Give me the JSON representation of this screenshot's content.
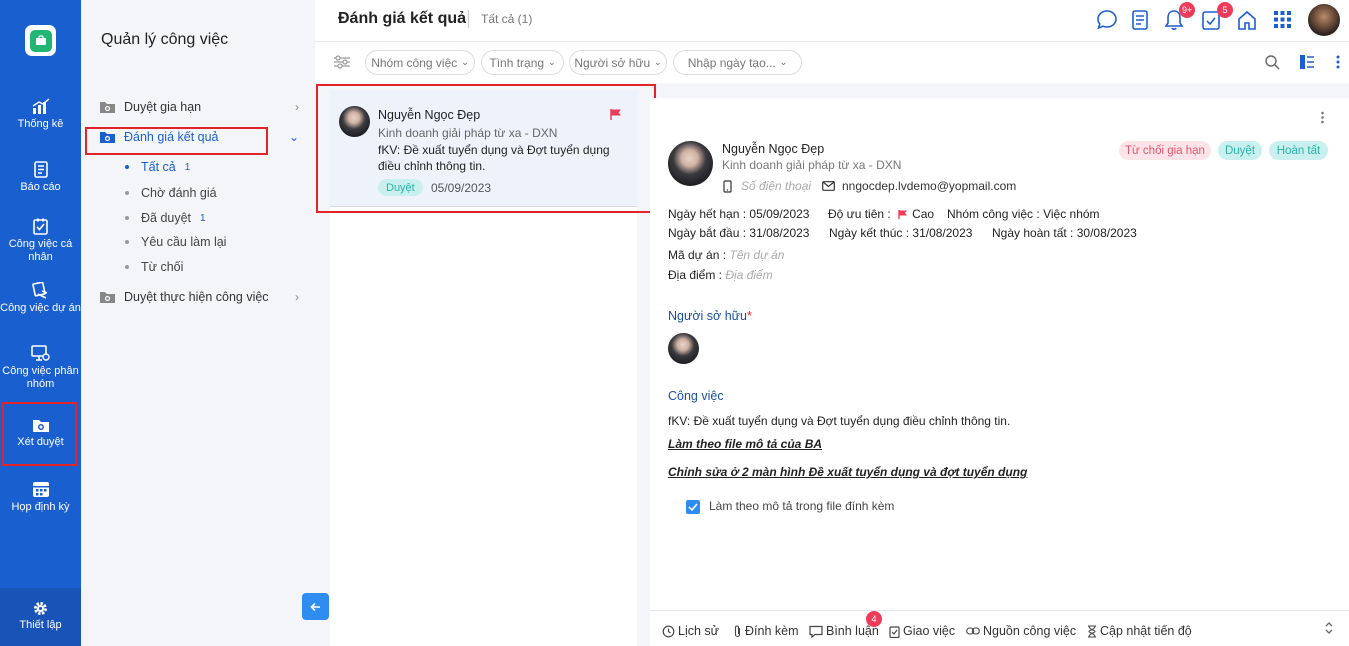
{
  "rail": {
    "items": [
      {
        "label": "Thống kê",
        "icon": "chart-icon"
      },
      {
        "label": "Báo cáo",
        "icon": "report-icon"
      },
      {
        "label": "Công việc cá nhân",
        "icon": "personal-task-icon"
      },
      {
        "label": "Công việc dự án",
        "icon": "project-task-icon"
      },
      {
        "label": "Công việc phân nhóm",
        "icon": "group-task-icon"
      },
      {
        "label": "Xét duyệt",
        "icon": "approval-folder-icon"
      },
      {
        "label": "Họp định kỳ",
        "icon": "calendar-icon"
      }
    ],
    "settings_label": "Thiết lập"
  },
  "sidebar": {
    "title": "Quản lý công việc",
    "groups": [
      {
        "label": "Duyệt gia hạn"
      },
      {
        "label": "Đánh giá kết quả"
      },
      {
        "label": "Duyệt thực hiện công việc"
      }
    ],
    "subitems": [
      {
        "label": "Tất cả",
        "count": "1"
      },
      {
        "label": "Chờ đánh giá",
        "count": ""
      },
      {
        "label": "Đã duyệt",
        "count": "1"
      },
      {
        "label": "Yêu cầu làm lại",
        "count": ""
      },
      {
        "label": "Từ chối",
        "count": ""
      }
    ]
  },
  "header": {
    "title": "Đánh giá kết quả",
    "count_label": "Tất cả (1)",
    "notif_badge": "9+",
    "task_badge": "5"
  },
  "filters": {
    "chips": [
      "Nhóm công việc",
      "Tình trạng",
      "Người sở hữu",
      "Nhập ngày tạo..."
    ]
  },
  "card": {
    "name": "Nguyễn Ngọc Đẹp",
    "dept": "Kinh doanh giải pháp từ xa - DXN",
    "desc": "fKV: Đề xuất tuyển dụng và Đợt tuyển dụng điều chỉnh thông tin.",
    "tag": "Duyệt",
    "date": "05/09/2023"
  },
  "detail": {
    "name": "Nguyễn Ngọc Đẹp",
    "dept": "Kinh doanh giải pháp từ xa - DXN",
    "phone_placeholder": "Số điện thoại",
    "email": "nngocdep.lvdemo@yopmail.com",
    "pills": [
      "Từ chối gia hạn",
      "Duyệt",
      "Hoàn tất"
    ],
    "due_label": "Ngày hết hạn :",
    "due": "05/09/2023",
    "priority_label": "Độ ưu tiên :",
    "priority": "Cao",
    "group_label": "Nhóm công việc :",
    "group": "Việc nhóm",
    "start_label": "Ngày bắt đầu :",
    "start": "31/08/2023",
    "end_label": "Ngày kết thúc :",
    "end": "31/08/2023",
    "done_label": "Ngày hoàn tất :",
    "done": "30/08/2023",
    "project_label": "Mã dự án :",
    "project_placeholder": "Tên dự án",
    "location_label": "Địa điểm :",
    "location_placeholder": "Địa điểm",
    "owner_title": "Người sở hữu",
    "owner_required": "*",
    "task_title": "Công việc",
    "task_text": "fKV: Đề xuất tuyển dụng và Đợt tuyển dụng điều chỉnh thông tin.",
    "link1": "Làm theo file mô tả của BA",
    "link2": "Chỉnh sửa ở 2 màn hình Đề xuất tuyển dụng và đợt tuyển dụng",
    "checklist_item": "Làm theo mô tả trong file đính kèm"
  },
  "bottombar": {
    "history": "Lịch sử",
    "attach": "Đính kèm",
    "comment": "Bình luận",
    "comment_badge": "4",
    "assign": "Giao việc",
    "source": "Nguồn công việc",
    "progress": "Cập nhật tiến độ"
  },
  "colors": {
    "rail": "#1a5fd0",
    "accent": "#2f8cf0",
    "highlight": "#e2232a",
    "teal": "#2bb3a8",
    "reject": "#e5546b"
  }
}
